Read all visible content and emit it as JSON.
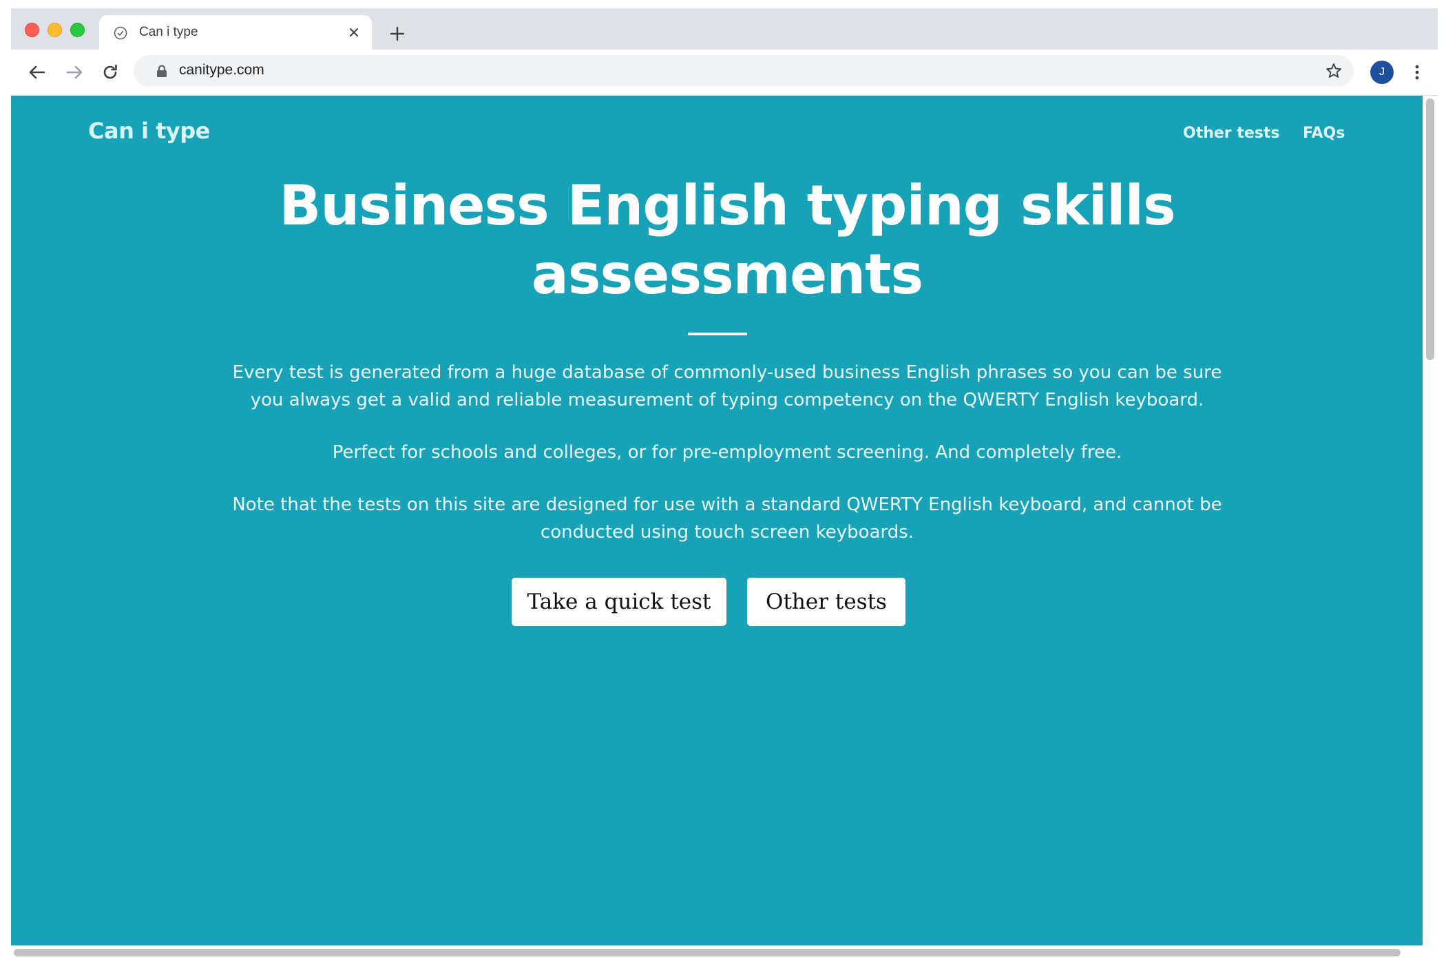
{
  "browser": {
    "tab_title": "Can i type",
    "url": "canitype.com",
    "avatar_initial": "J",
    "new_tab_label": "+"
  },
  "site": {
    "brand": "Can i type",
    "nav": [
      {
        "label": "Other tests"
      },
      {
        "label": "FAQs"
      }
    ]
  },
  "hero": {
    "title_line1": "Business English typing skills",
    "title_line2": "assessments",
    "para1_line1": "Every test is generated from a huge database of commonly-used business English phrases so you can be sure",
    "para1_line2": "you always get a valid and reliable measurement of typing competency on the QWERTY English keyboard.",
    "para2": "Perfect for schools and colleges, or for pre-employment screening. And completely free.",
    "para3_line1": "Note that the tests on this site are designed for use with a standard QWERTY English keyboard, and cannot be",
    "para3_line2": "conducted using touch screen keyboards.",
    "buttons": [
      {
        "label": "Take a quick test"
      },
      {
        "label": "Other tests"
      }
    ]
  },
  "colors": {
    "page_background": "#17a2b8",
    "tabstrip": "#dee1e6",
    "avatar": "#1d4f9c"
  },
  "icons": {
    "traffic_lights": [
      "close-dot",
      "minimize-dot",
      "zoom-dot"
    ],
    "tab": [
      "favicon-clock-icon",
      "close-icon"
    ],
    "toolbar": [
      "back-arrow-icon",
      "forward-arrow-icon",
      "reload-icon",
      "lock-icon",
      "bookmark-star-icon",
      "kebab-menu-icon"
    ]
  }
}
